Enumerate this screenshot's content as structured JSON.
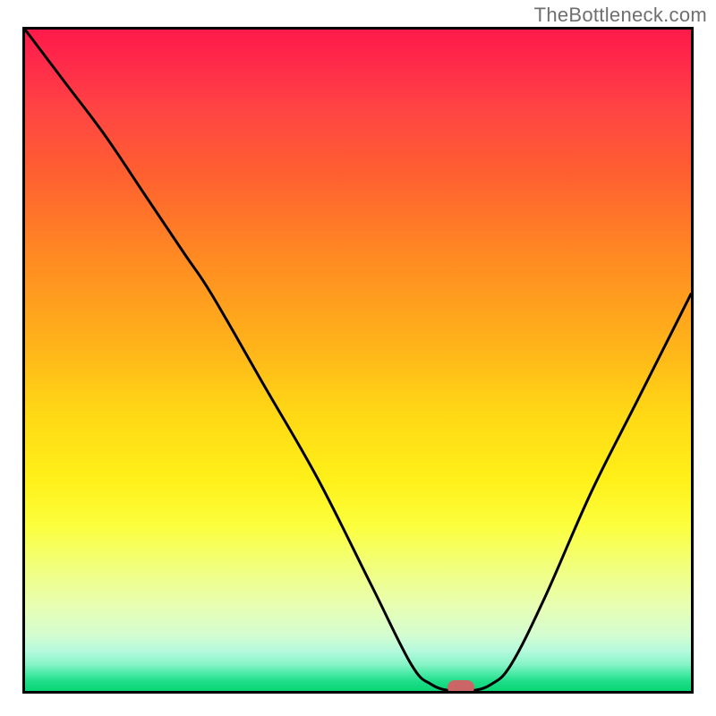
{
  "watermark": "TheBottleneck.com",
  "chart_data": {
    "type": "line",
    "title": "",
    "xlabel": "",
    "ylabel": "",
    "xlim": [
      0,
      100
    ],
    "ylim": [
      0,
      100
    ],
    "grid": false,
    "legend": false,
    "series": [
      {
        "name": "bottleneck-curve",
        "x": [
          0,
          6,
          12,
          18,
          24,
          28,
          36,
          44,
          52,
          58,
          61,
          64,
          67,
          70,
          73,
          78,
          85,
          92,
          100
        ],
        "y": [
          100,
          92,
          84,
          75,
          66,
          60,
          46,
          32,
          16,
          4,
          1,
          0,
          0,
          1,
          4,
          14,
          30,
          44,
          60
        ]
      }
    ],
    "marker": {
      "x": 65.5,
      "y": 0.6,
      "color": "#cc6666"
    },
    "background_gradient": {
      "stops": [
        {
          "pos": 0.0,
          "color": "#ff1a4a"
        },
        {
          "pos": 0.35,
          "color": "#ff8c22"
        },
        {
          "pos": 0.68,
          "color": "#fff019"
        },
        {
          "pos": 0.94,
          "color": "#b4fadc"
        },
        {
          "pos": 1.0,
          "color": "#0ad676"
        }
      ]
    }
  }
}
